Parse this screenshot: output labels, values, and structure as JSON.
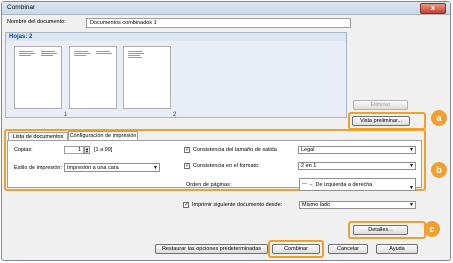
{
  "window": {
    "title": "Combinar",
    "close_symbol": "x"
  },
  "doc_name": {
    "label": "Nombre del documento:",
    "value": "Documentos combinados 1"
  },
  "sheets": {
    "header": "Hojas: 2",
    "pages": [
      "1",
      "2"
    ]
  },
  "buttons": {
    "delete": "Eliminar",
    "preview": "Vista preliminar...",
    "details": "Detalles...",
    "restore": "Restaurar las opciones predeterminadas",
    "combine": "Combinar",
    "cancel": "Cancelar",
    "help": "Ayuda"
  },
  "tabs": [
    "Lista de documentos",
    "Configuración de impresión"
  ],
  "print": {
    "copies_label": "Copias:",
    "copies_value": "1",
    "copies_range": "[1 a 99]",
    "style_label": "Estilo de impresión:",
    "style_value": "Impresión a una cara",
    "paper_size_label": "Consistencia del tamaño de salida",
    "paper_size_value": "Legal",
    "format_label": "Consistencia en el formato:",
    "format_value": "2 en 1",
    "page_order_label": "Orden de páginas:",
    "page_order_value": "De izquierda a derecha",
    "next_doc_label": "Imprimir siguiente documento desde:",
    "next_doc_value": "Mismo lado"
  },
  "badges": [
    "a",
    "b",
    "c"
  ],
  "colors": {
    "accent": "#f0a030",
    "link": "#0050a0"
  }
}
